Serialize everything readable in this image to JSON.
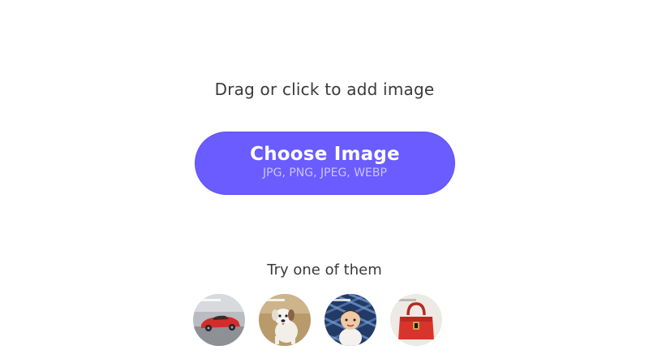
{
  "upload": {
    "prompt": "Drag or click to add image",
    "button_label": "Choose Image",
    "formats": "JPG, PNG, JPEG, WEBP"
  },
  "samples": {
    "label": "Try one of them",
    "items": [
      {
        "subject": "red sports car"
      },
      {
        "subject": "white dog"
      },
      {
        "subject": "baby"
      },
      {
        "subject": "red handbag"
      }
    ]
  },
  "colors": {
    "accent": "#6a5cff",
    "button_text": "#ffffff",
    "formats_text": "#c9c3ff",
    "body_text": "#3a3a3a",
    "background": "#ffffff"
  }
}
